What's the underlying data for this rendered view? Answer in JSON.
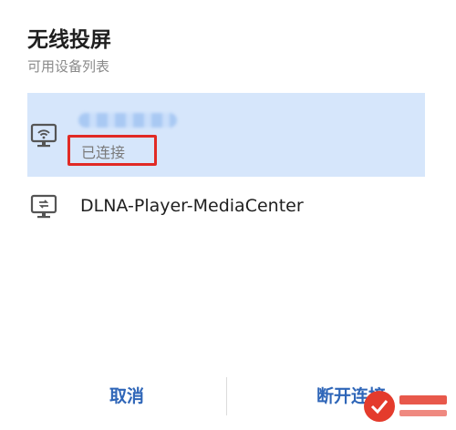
{
  "dialog": {
    "title": "无线投屏",
    "subtitle": "可用设备列表"
  },
  "devices": [
    {
      "name": "",
      "status": "已连接",
      "icon": "cast-wifi-monitor-icon",
      "selected": true
    },
    {
      "name": "DLNA-Player-MediaCenter",
      "icon": "dlna-monitor-icon",
      "selected": false
    }
  ],
  "footer": {
    "cancel_label": "取消",
    "disconnect_label": "断开连接"
  },
  "colors": {
    "accent": "#2f66b8",
    "selected_row_bg": "#d6e6fb",
    "highlight_box": "#e12a25"
  }
}
